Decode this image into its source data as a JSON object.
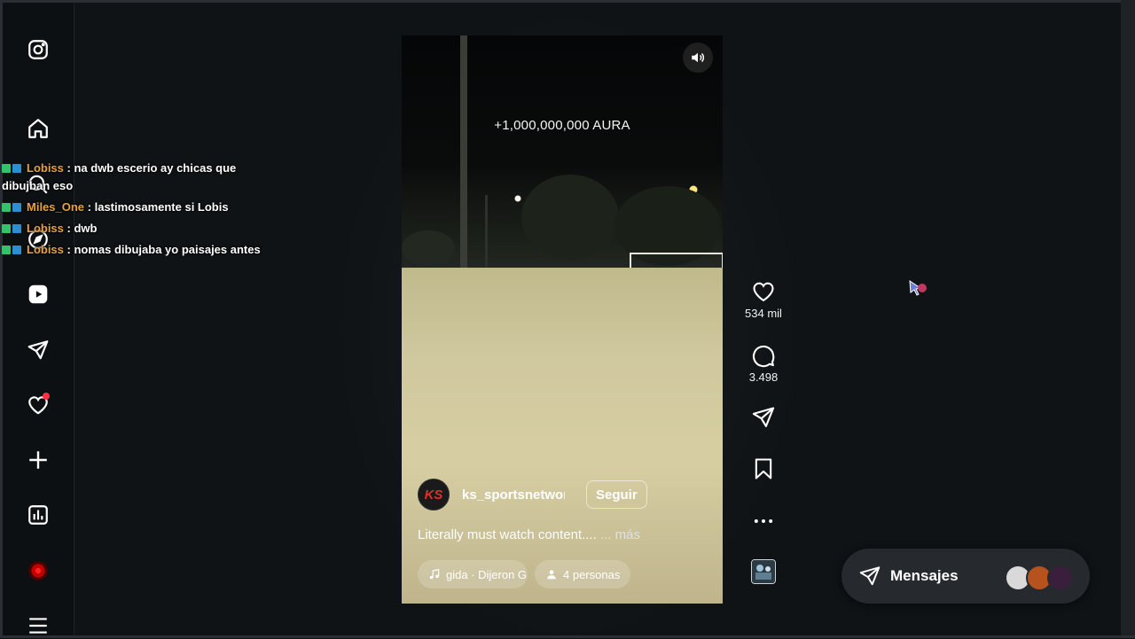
{
  "app": {
    "name": "Instagram Reels"
  },
  "sidebar": {
    "items": [
      {
        "name": "instagram-logo",
        "icon": "instagram-logo-icon"
      },
      {
        "name": "home",
        "icon": "home-icon"
      },
      {
        "name": "search",
        "icon": "search-icon"
      },
      {
        "name": "explore",
        "icon": "compass-icon"
      },
      {
        "name": "reels",
        "icon": "reels-icon"
      },
      {
        "name": "messages",
        "icon": "send-icon"
      },
      {
        "name": "notifications",
        "icon": "heart-icon",
        "has_dot": true
      },
      {
        "name": "create",
        "icon": "plus-icon"
      },
      {
        "name": "dashboard",
        "icon": "chart-icon"
      },
      {
        "name": "profile",
        "icon": "avatar-icon"
      },
      {
        "name": "more",
        "icon": "menu-icon"
      }
    ]
  },
  "reel": {
    "overlay_text": "+1,000,000,000 AURA",
    "author": {
      "avatar_text": "KS",
      "username": "ks_sportsnetwor",
      "follow_label": "Seguir"
    },
    "caption": "Literally must watch content....",
    "caption_more": "... más",
    "audio_label": "gida · Dijeron G",
    "tagged_label": "4 personas"
  },
  "actions": {
    "likes": "534 mil",
    "comments": "3.498"
  },
  "chat": [
    {
      "user": "Lobiss",
      "text": ": na dwb escerio ay chicas que dibujban eso"
    },
    {
      "user": "Miles_One",
      "text": ": lastimosamente si Lobis"
    },
    {
      "user": "Lobiss",
      "text": ": dwb"
    },
    {
      "user": "Lobiss",
      "text": ": nomas dibujaba yo paisajes antes"
    }
  ],
  "messages_bar": {
    "label": "Mensajes"
  },
  "colors": {
    "background": "#0f1316",
    "chat_user": "#e8a23a",
    "notification_dot": "#ff3040",
    "messages_pill": "#262a2e"
  }
}
